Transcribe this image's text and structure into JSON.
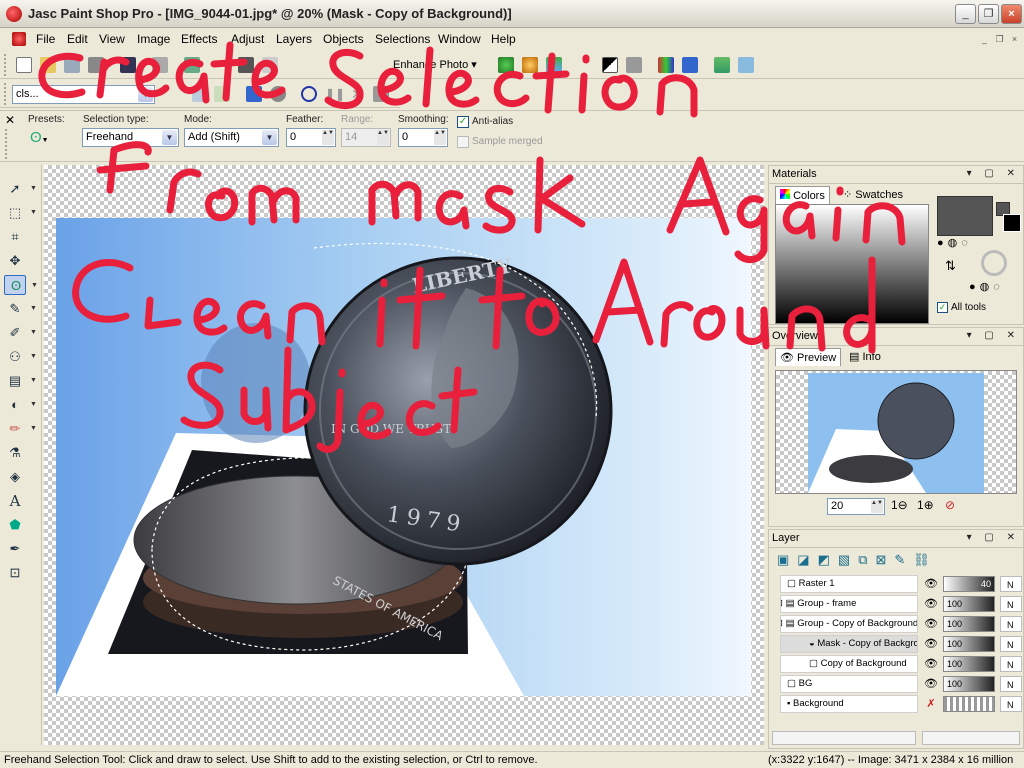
{
  "window": {
    "title": "Jasc Paint Shop Pro - [IMG_9044-01.jpg* @  20% (Mask - Copy of Background)]",
    "min_label": "_",
    "max_label": "❐",
    "close_label": "×"
  },
  "menu": {
    "items": [
      "File",
      "Edit",
      "View",
      "Image",
      "Effects",
      "Adjust",
      "Layers",
      "Objects",
      "Selections",
      "Window",
      "Help"
    ],
    "mdi_buttons": [
      "_",
      "❐",
      "×"
    ]
  },
  "toolbar": {
    "enhance_photo": "Enhance Photo",
    "script_combo": "cls..."
  },
  "tool_options": {
    "presets_label": "Presets:",
    "selection_type_label": "Selection type:",
    "selection_type_value": "Freehand",
    "mode_label": "Mode:",
    "mode_value": "Add (Shift)",
    "feather_label": "Feather:",
    "feather_value": "0",
    "range_label": "Range:",
    "range_value": "14",
    "smoothing_label": "Smoothing:",
    "smoothing_value": "0",
    "antialias_label": "Anti-alias",
    "antialias_checked": true,
    "sample_merged_label": "Sample merged",
    "sample_merged_checked": false
  },
  "materials": {
    "title": "Materials",
    "tabs": [
      "Colors",
      "Swatches"
    ],
    "all_tools_label": "All tools",
    "all_tools_checked": true,
    "foreground_color": "#555555",
    "background_color": "#ffffff"
  },
  "overview": {
    "title": "Overview",
    "tabs": [
      "Preview",
      "Info"
    ],
    "zoom_value": "20"
  },
  "layers": {
    "title": "Layer",
    "rows": [
      {
        "name": "Raster 1",
        "opacity": "40",
        "mode": "N"
      },
      {
        "name": "Group - frame",
        "opacity": "100",
        "mode": "N"
      },
      {
        "name": "Group - Copy of Background",
        "opacity": "100",
        "mode": "N"
      },
      {
        "name": "Mask - Copy of Background",
        "opacity": "100",
        "mode": "N"
      },
      {
        "name": "Copy of Background",
        "opacity": "100",
        "mode": "N"
      },
      {
        "name": "BG",
        "opacity": "100",
        "mode": "N"
      },
      {
        "name": "Background",
        "opacity": "",
        "mode": "N"
      }
    ]
  },
  "status": {
    "hint": "Freehand Selection Tool: Click and draw to select. Use Shift to add to the existing selection, or Ctrl to remove.",
    "info": "(x:3322 y:1647) -- Image:  3471 x 2384 x 16 million"
  },
  "annotation": {
    "lines": [
      "Create Selection",
      "from mask Again",
      "Clean it to Around",
      "Subject"
    ],
    "color": "#e8203c"
  },
  "photo": {
    "coin_text_liberty": "LIBERTY",
    "coin_text_trust": "IN GOD WE TRUST",
    "coin_year": "1979",
    "stack_text": "STATES OF AMERICA"
  }
}
